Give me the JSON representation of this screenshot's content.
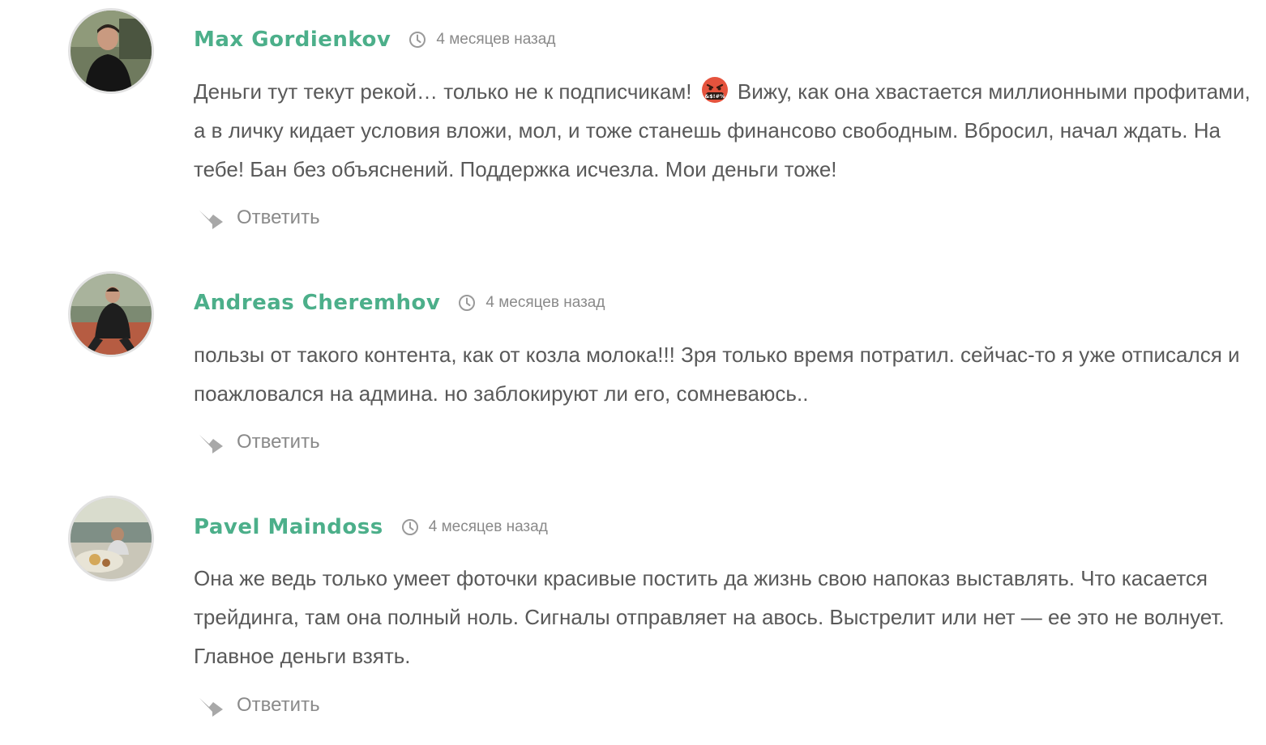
{
  "comments": [
    {
      "author": "Max Gordienkov",
      "time": "4 месяцев назад",
      "text_before_emoji": "Деньги тут текут рекой… только не к подписчикам! ",
      "emoji": "face-with-symbols-on-mouth",
      "text_after_emoji": " Вижу, как она хвастается миллионными профитами, а в личку кидает условия вложи, мол, и тоже станешь финансово свободным. Вбросил, начал ждать. На тебе! Бан без объяснений. Поддержка исчезла. Мои деньги тоже!",
      "reply_label": "Ответить"
    },
    {
      "author": "Andreas Cheremhov",
      "time": "4 месяцев назад",
      "text": "пользы от такого контента, как от козла молока!!! Зря только время потратил. сейчас-то я уже отписался и поажловался на админа. но заблокируют ли его, сомневаюсь..",
      "reply_label": "Ответить"
    },
    {
      "author": "Pavel Maindoss",
      "time": "4 месяцев назад",
      "text": "Она же ведь только умеет фоточки красивые постить да жизнь свою напоказ выставлять. Что касается трейдинга, там она полный ноль. Сигналы отправляет на авось. Выстрелит или нет — ее это не волнует. Главное деньги взять.",
      "reply_label": "Ответить"
    }
  ],
  "colors": {
    "author": "#4caf8a",
    "text": "#595959",
    "muted": "#8a8a8a",
    "avatar_border": "#e2e2e2"
  },
  "icons": {
    "time": "clock-icon",
    "reply": "reply-arrow-icon"
  }
}
